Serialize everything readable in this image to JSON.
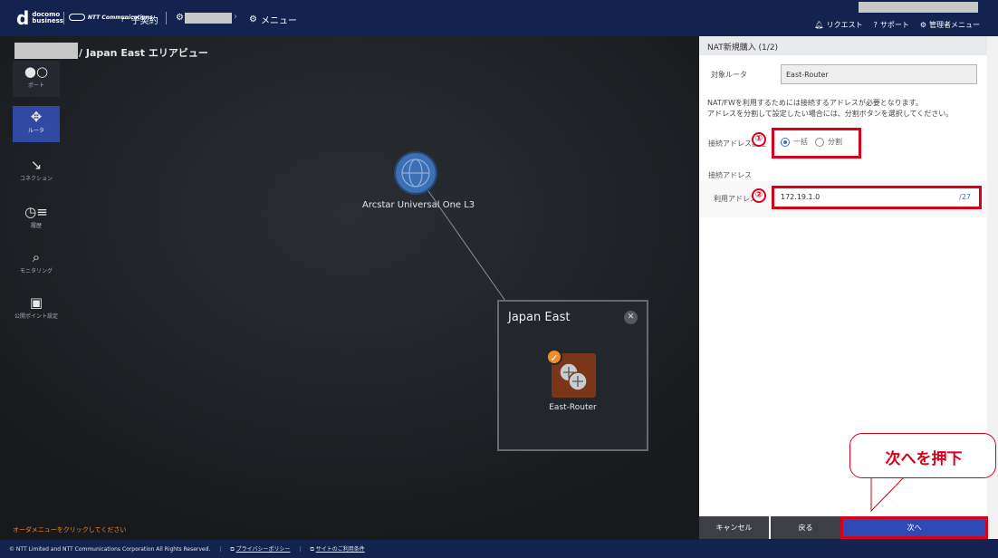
{
  "header": {
    "brand_top": "docomo",
    "brand_bottom": "business",
    "ntt_logo_text": "NTT Communications",
    "contract_label": "子契約",
    "menu_label": "メニュー",
    "links": [
      "リクエスト",
      "サポート",
      "管理者メニュー"
    ]
  },
  "rail": {
    "items": [
      {
        "label": "ポート",
        "icon": "port-icon"
      },
      {
        "label": "ルータ",
        "icon": "router-icon"
      },
      {
        "label": "コネクション",
        "icon": "connection-icon"
      },
      {
        "label": "履歴",
        "icon": "history-icon"
      },
      {
        "label": "モニタリング",
        "icon": "monitoring-icon"
      },
      {
        "label": "公開ポイント設定",
        "icon": "public-point-icon"
      }
    ]
  },
  "canvas": {
    "area_title": "/ Japan East エリアビュー",
    "cloud_label": "Arcstar Universal One L3",
    "region_title": "Japan East",
    "router_label": "East-Router",
    "order_hint": "オーダメニューをクリックしてください"
  },
  "panel": {
    "title": "NAT新規購入 (1/2)",
    "target_router_label": "対象ルータ",
    "target_router_value": "East-Router",
    "notice": [
      "NAT/FWを利用するためには接続するアドレスが必要となります。",
      "アドレスを分割して設定したい場合には、分割ボタンを選択してください。"
    ],
    "connect_setting_label": "接続アドレス設定",
    "radio_options": [
      "一括",
      "分割"
    ],
    "selected_radio": "一括",
    "section_title": "接続アドレス",
    "use_address_label": "利用アドレス",
    "use_address_value": "172.19.1.0",
    "use_address_prefix": "/27"
  },
  "annotations": {
    "badge1": "①",
    "badge2": "②",
    "callout": "次へを押下",
    "highlight_color": "#d9001b"
  },
  "buttons": {
    "cancel": "キャンセル",
    "back": "戻る",
    "next": "次へ"
  },
  "footer": {
    "copyright": "© NTT Limited and NTT Communications Corporation All Rights Reserved.",
    "privacy": "プライバシーポリシー",
    "terms": "サイトのご利用条件"
  },
  "colors": {
    "header_bg": "#12234f",
    "accent_blue": "#2f4ab5",
    "router_tile": "#7a3619",
    "check_orange": "#f28c2a"
  }
}
